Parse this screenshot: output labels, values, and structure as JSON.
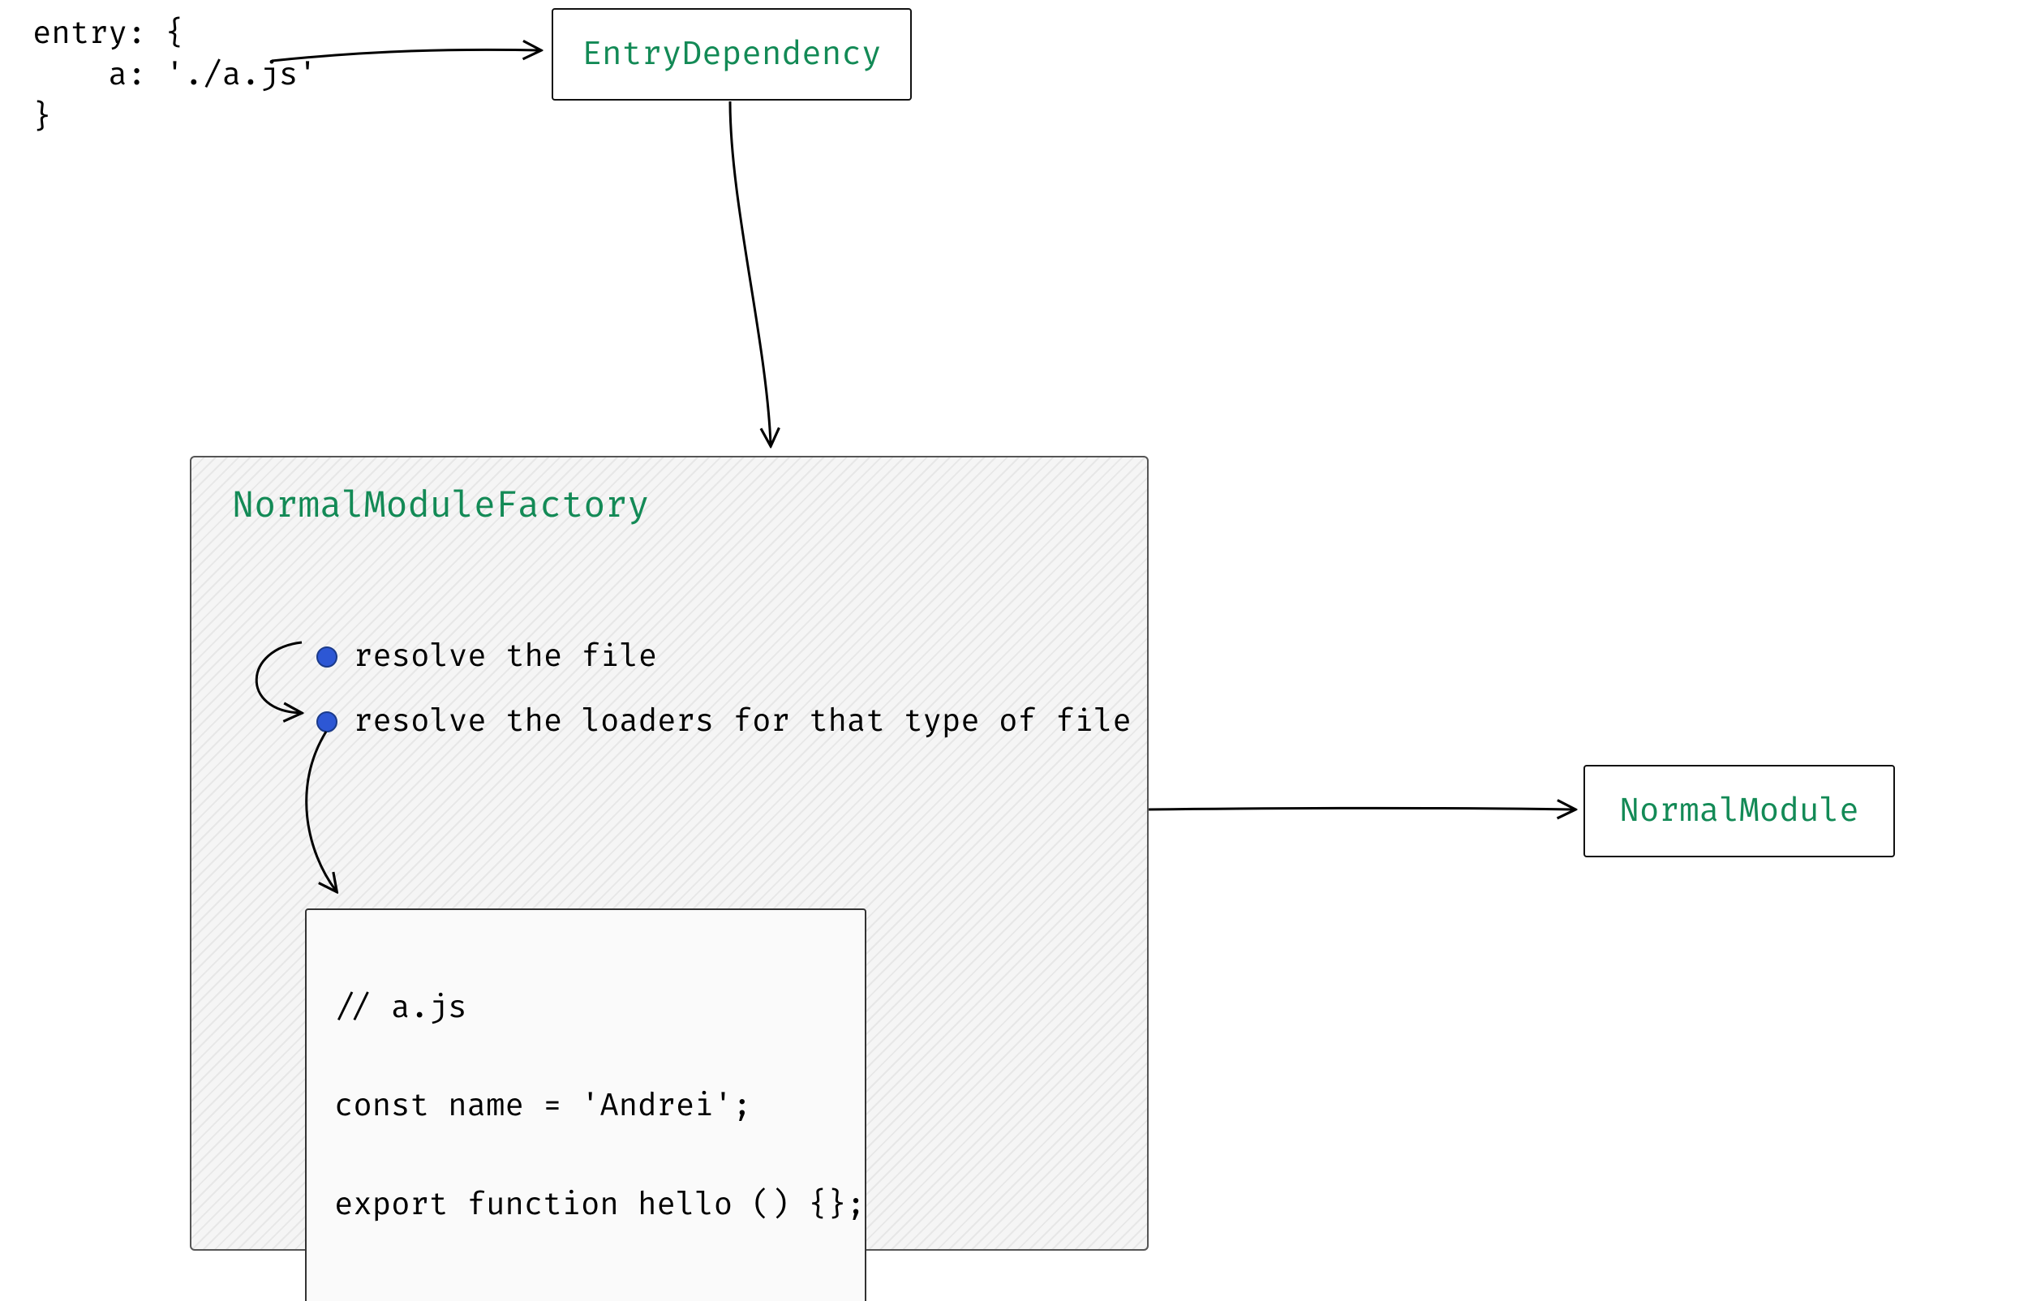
{
  "entry_snippet": "entry: {\n    a: './a.js'\n}",
  "entry_dependency_box": {
    "label": "EntryDependency"
  },
  "factory": {
    "title": "NormalModuleFactory",
    "bullets": [
      "resolve the file",
      "resolve the loaders for that type of file"
    ],
    "file_content": "// a.js\n\nconst name = 'Andrei';\n\nexport function hello () {};"
  },
  "normal_module_box": {
    "label": "NormalModule"
  },
  "colors": {
    "accent": "#138a56",
    "bullet": "#2d57d4"
  }
}
